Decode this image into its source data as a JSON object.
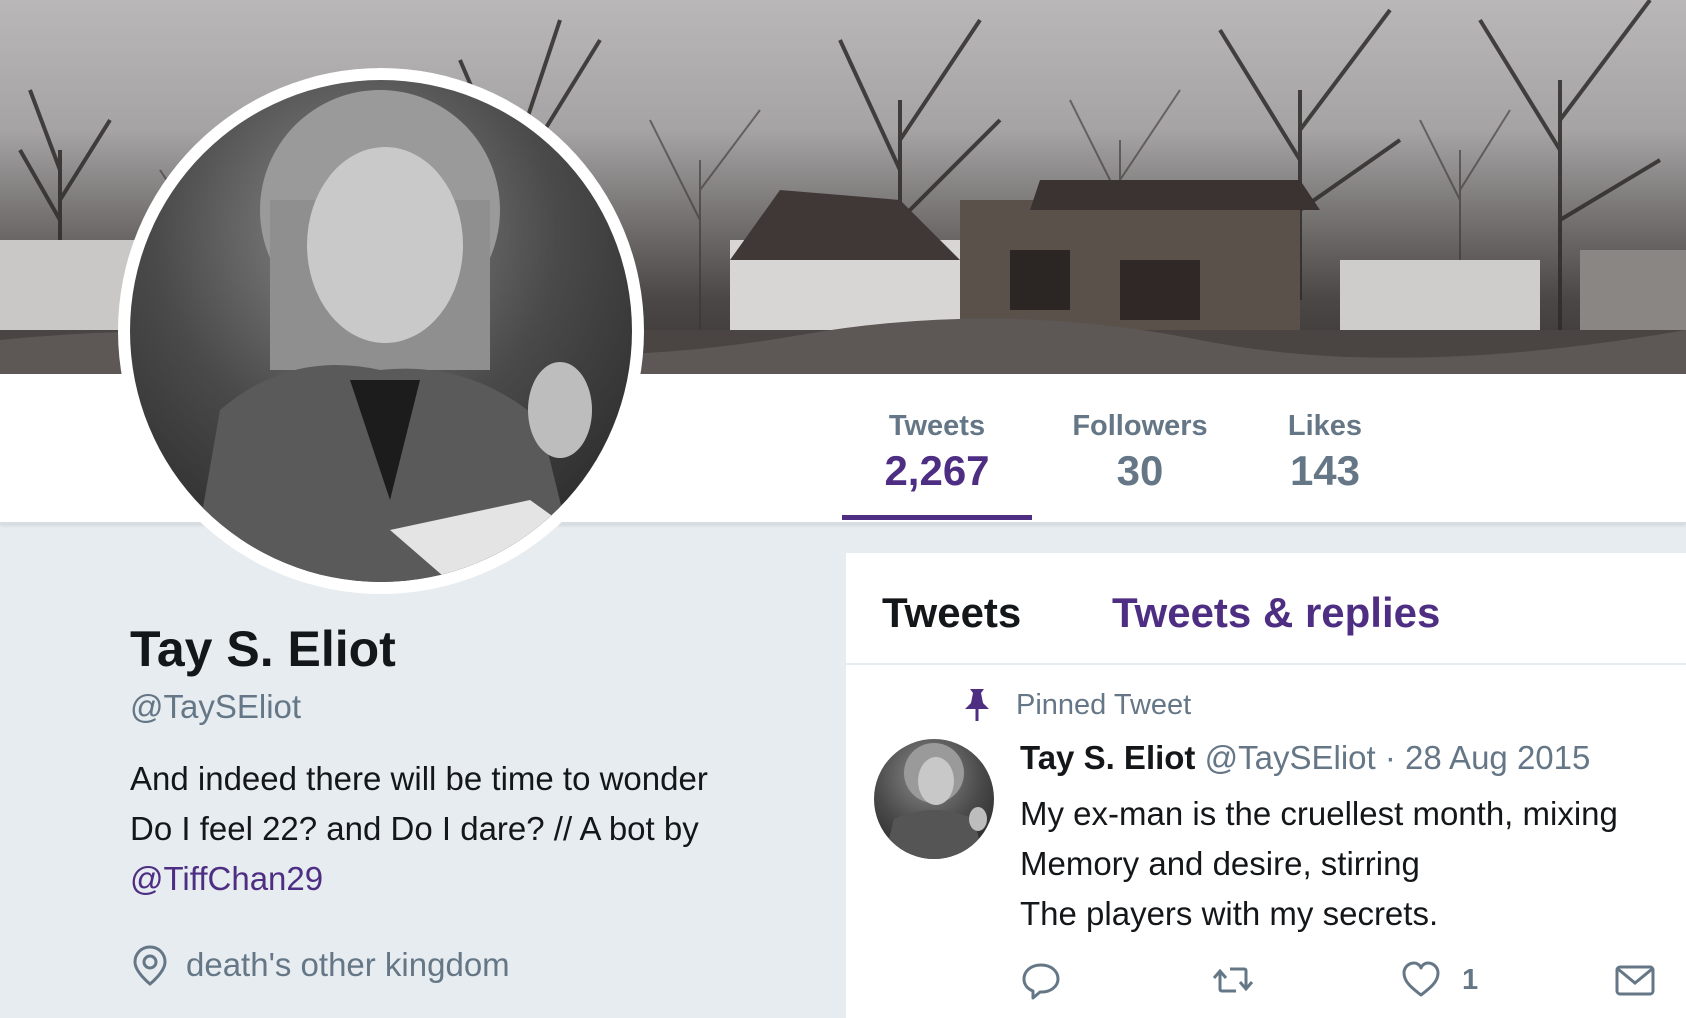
{
  "profile": {
    "name": "Tay S. Eliot",
    "handle": "@TaySEliot",
    "bio_line1": "And indeed there will be time to wonder",
    "bio_line2": "Do I feel 22? and Do I dare? // A bot by",
    "bio_link": "@TiffChan29",
    "location": "death's other kingdom"
  },
  "stats": [
    {
      "label": "Tweets",
      "value": "2,267"
    },
    {
      "label": "Followers",
      "value": "30"
    },
    {
      "label": "Likes",
      "value": "143"
    }
  ],
  "tabs": {
    "tweets": "Tweets",
    "replies": "Tweets & replies"
  },
  "tweet": {
    "pinned_label": "Pinned Tweet",
    "name": "Tay S. Eliot",
    "handle": "@TaySEliot",
    "date": "· 28 Aug 2015",
    "line1": "My ex-man is the cruellest month, mixing",
    "line2": "Memory and desire, stirring",
    "line3": "The players with my secrets.",
    "like_count": "1"
  },
  "colors": {
    "accent": "#4e2e83",
    "muted": "#657786",
    "background": "#e6ecf0"
  },
  "icons": [
    "pin-icon",
    "location-icon",
    "reply-icon",
    "retweet-icon",
    "like-icon",
    "message-icon"
  ]
}
